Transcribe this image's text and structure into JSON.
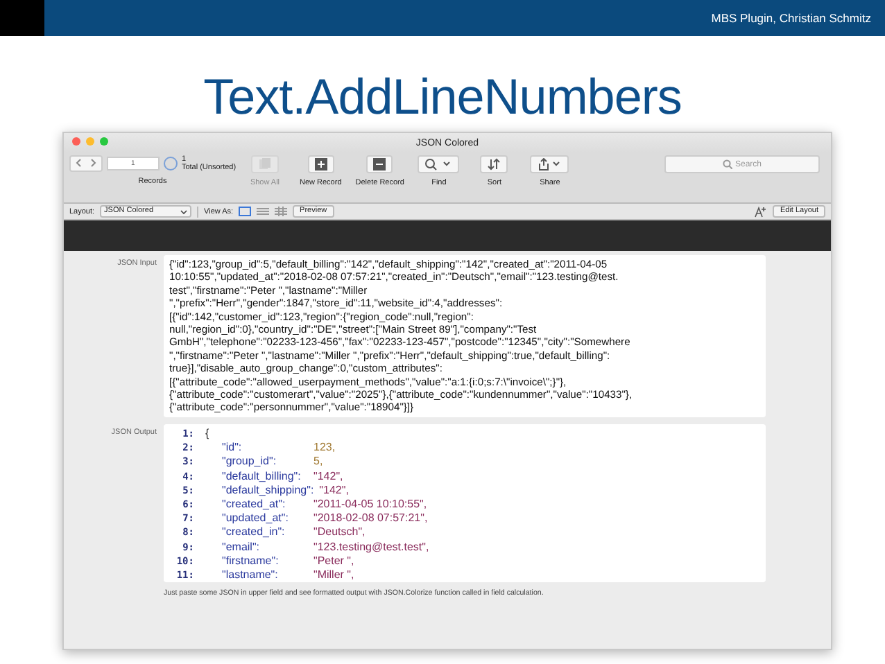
{
  "slide": {
    "header": "MBS Plugin, Christian Schmitz",
    "title": "Text.AddLineNumbers"
  },
  "window": {
    "title": "JSON Colored"
  },
  "toolbar": {
    "record_number": "1",
    "record_count": "1",
    "record_total": "Total (Unsorted)",
    "records_label": "Records",
    "buttons": [
      {
        "kind": "show_all",
        "label": "Show All",
        "disabled": true
      },
      {
        "kind": "new",
        "label": "New Record",
        "disabled": false
      },
      {
        "kind": "delete",
        "label": "Delete Record",
        "disabled": false
      },
      {
        "kind": "find",
        "label": "Find",
        "disabled": false
      },
      {
        "kind": "sort",
        "label": "Sort",
        "disabled": false
      },
      {
        "kind": "share",
        "label": "Share",
        "disabled": false
      }
    ],
    "search": {
      "placeholder": "Search"
    }
  },
  "layout_bar": {
    "layout_label": "Layout:",
    "layout": "JSON Colored",
    "view_as_label": "View As:",
    "views": [
      {
        "kind": "form",
        "selected": true
      },
      {
        "kind": "list",
        "selected": false
      },
      {
        "kind": "table",
        "selected": false
      }
    ],
    "preview": "Preview",
    "edit_layout": "Edit Layout"
  },
  "input": {
    "label": "JSON Input",
    "lines": [
      "{\"id\":123,\"group_id\":5,\"default_billing\":\"142\",\"default_shipping\":\"142\",\"created_at\":\"2011-04-05",
      "10:10:55\",\"updated_at\":\"2018-02-08 07:57:21\",\"created_in\":\"Deutsch\",\"email\":\"123.testing@test.",
      "test\",\"firstname\":\"Peter \",\"lastname\":\"Miller",
      "\",\"prefix\":\"Herr\",\"gender\":1847,\"store_id\":11,\"website_id\":4,\"addresses\":",
      "[{\"id\":142,\"customer_id\":123,\"region\":{\"region_code\":null,\"region\":",
      "null,\"region_id\":0},\"country_id\":\"DE\",\"street\":[\"Main Street 89\"],\"company\":\"Test",
      "GmbH\",\"telephone\":\"02233-123-456\",\"fax\":\"02233-123-457\",\"postcode\":\"12345\",\"city\":\"Somewhere",
      "\",\"firstname\":\"Peter \",\"lastname\":\"Miller \",\"prefix\":\"Herr\",\"default_shipping\":true,\"default_billing\":",
      "true}],\"disable_auto_group_change\":0,\"custom_attributes\":",
      "[{\"attribute_code\":\"allowed_userpayment_methods\",\"value\":\"a:1:{i:0;s:7:\\\"invoice\\\";}\"},",
      "{\"attribute_code\":\"customerart\",\"value\":\"2025\"},{\"attribute_code\":\"kundennummer\",\"value\":\"10433\"},",
      "{\"attribute_code\":\"personnummer\",\"value\":\"18904\"}]}"
    ]
  },
  "output": {
    "label": "JSON Output",
    "lines": [
      {
        "number": "1:",
        "kind": "brace",
        "value": "{"
      },
      {
        "number": "2:",
        "kind": "number",
        "key": "\"id\":",
        "value": "123,"
      },
      {
        "number": "3:",
        "kind": "number",
        "key": "\"group_id\":",
        "value": "5,"
      },
      {
        "number": "4:",
        "kind": "string",
        "key": "\"default_billing\":",
        "value": "\"142\","
      },
      {
        "number": "5:",
        "kind": "string",
        "key": "\"default_shipping\":",
        "value": "\"142\","
      },
      {
        "number": "6:",
        "kind": "string",
        "key": "\"created_at\":",
        "value": "\"2011-04-05 10:10:55\","
      },
      {
        "number": "7:",
        "kind": "string",
        "key": "\"updated_at\":",
        "value": "\"2018-02-08 07:57:21\","
      },
      {
        "number": "8:",
        "kind": "string",
        "key": "\"created_in\":",
        "value": "\"Deutsch\","
      },
      {
        "number": "9:",
        "kind": "string",
        "key": "\"email\":",
        "value": "\"123.testing@test.test\","
      },
      {
        "number": "10:",
        "kind": "string",
        "key": "\"firstname\":",
        "value": "\"Peter \","
      },
      {
        "number": "11:",
        "kind": "string",
        "key": "\"lastname\":",
        "value": "\"Miller \","
      }
    ]
  },
  "footnote": "Just paste some JSON in upper field and see formatted output with JSON.Colorize function called in field calculation."
}
